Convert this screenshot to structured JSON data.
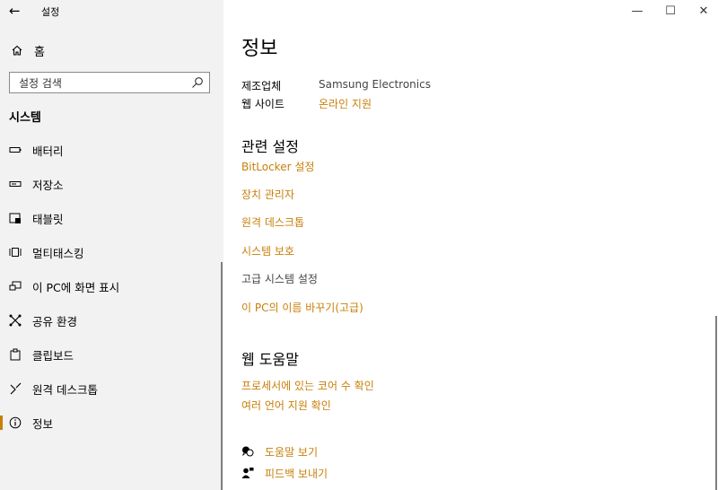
{
  "window": {
    "title": "설정",
    "back_icon": "back-arrow-icon",
    "controls": {
      "minimize": "—",
      "maximize": "☐",
      "close": "✕"
    }
  },
  "sidebar": {
    "home_label": "홈",
    "search_placeholder": "설정 검색",
    "section_title": "시스템",
    "items": [
      {
        "label": "배터리",
        "icon": "battery-icon"
      },
      {
        "label": "저장소",
        "icon": "storage-icon"
      },
      {
        "label": "태블릿",
        "icon": "tablet-icon"
      },
      {
        "label": "멀티태스킹",
        "icon": "multitasking-icon"
      },
      {
        "label": "이 PC에 화면 표시",
        "icon": "project-icon"
      },
      {
        "label": "공유 환경",
        "icon": "share-icon"
      },
      {
        "label": "클립보드",
        "icon": "clipboard-icon"
      },
      {
        "label": "원격 데스크톱",
        "icon": "remote-desktop-icon"
      },
      {
        "label": "정보",
        "icon": "info-icon",
        "active": true
      }
    ]
  },
  "main": {
    "title": "정보",
    "manufacturer_label": "제조업체",
    "manufacturer_value": "Samsung Electronics",
    "website_label": "웹 사이트",
    "website_value": "온라인 지원",
    "related_title": "관련 설정",
    "related_links": [
      "BitLocker 설정",
      "장치 관리자",
      "원격 데스크톱",
      "시스템 보호",
      "고급 시스템 설정",
      "이 PC의 이름 바꾸기(고급)"
    ],
    "web_help_title": "웹 도움말",
    "web_help_links": [
      "프로세서에 있는 코어 수 확인",
      "여러 언어 지원 확인"
    ],
    "get_help": "도움말 보기",
    "feedback": "피드백 보내기"
  },
  "colors": {
    "accent": "#c87f0a",
    "sidebar_bg": "#f2f2f2"
  }
}
